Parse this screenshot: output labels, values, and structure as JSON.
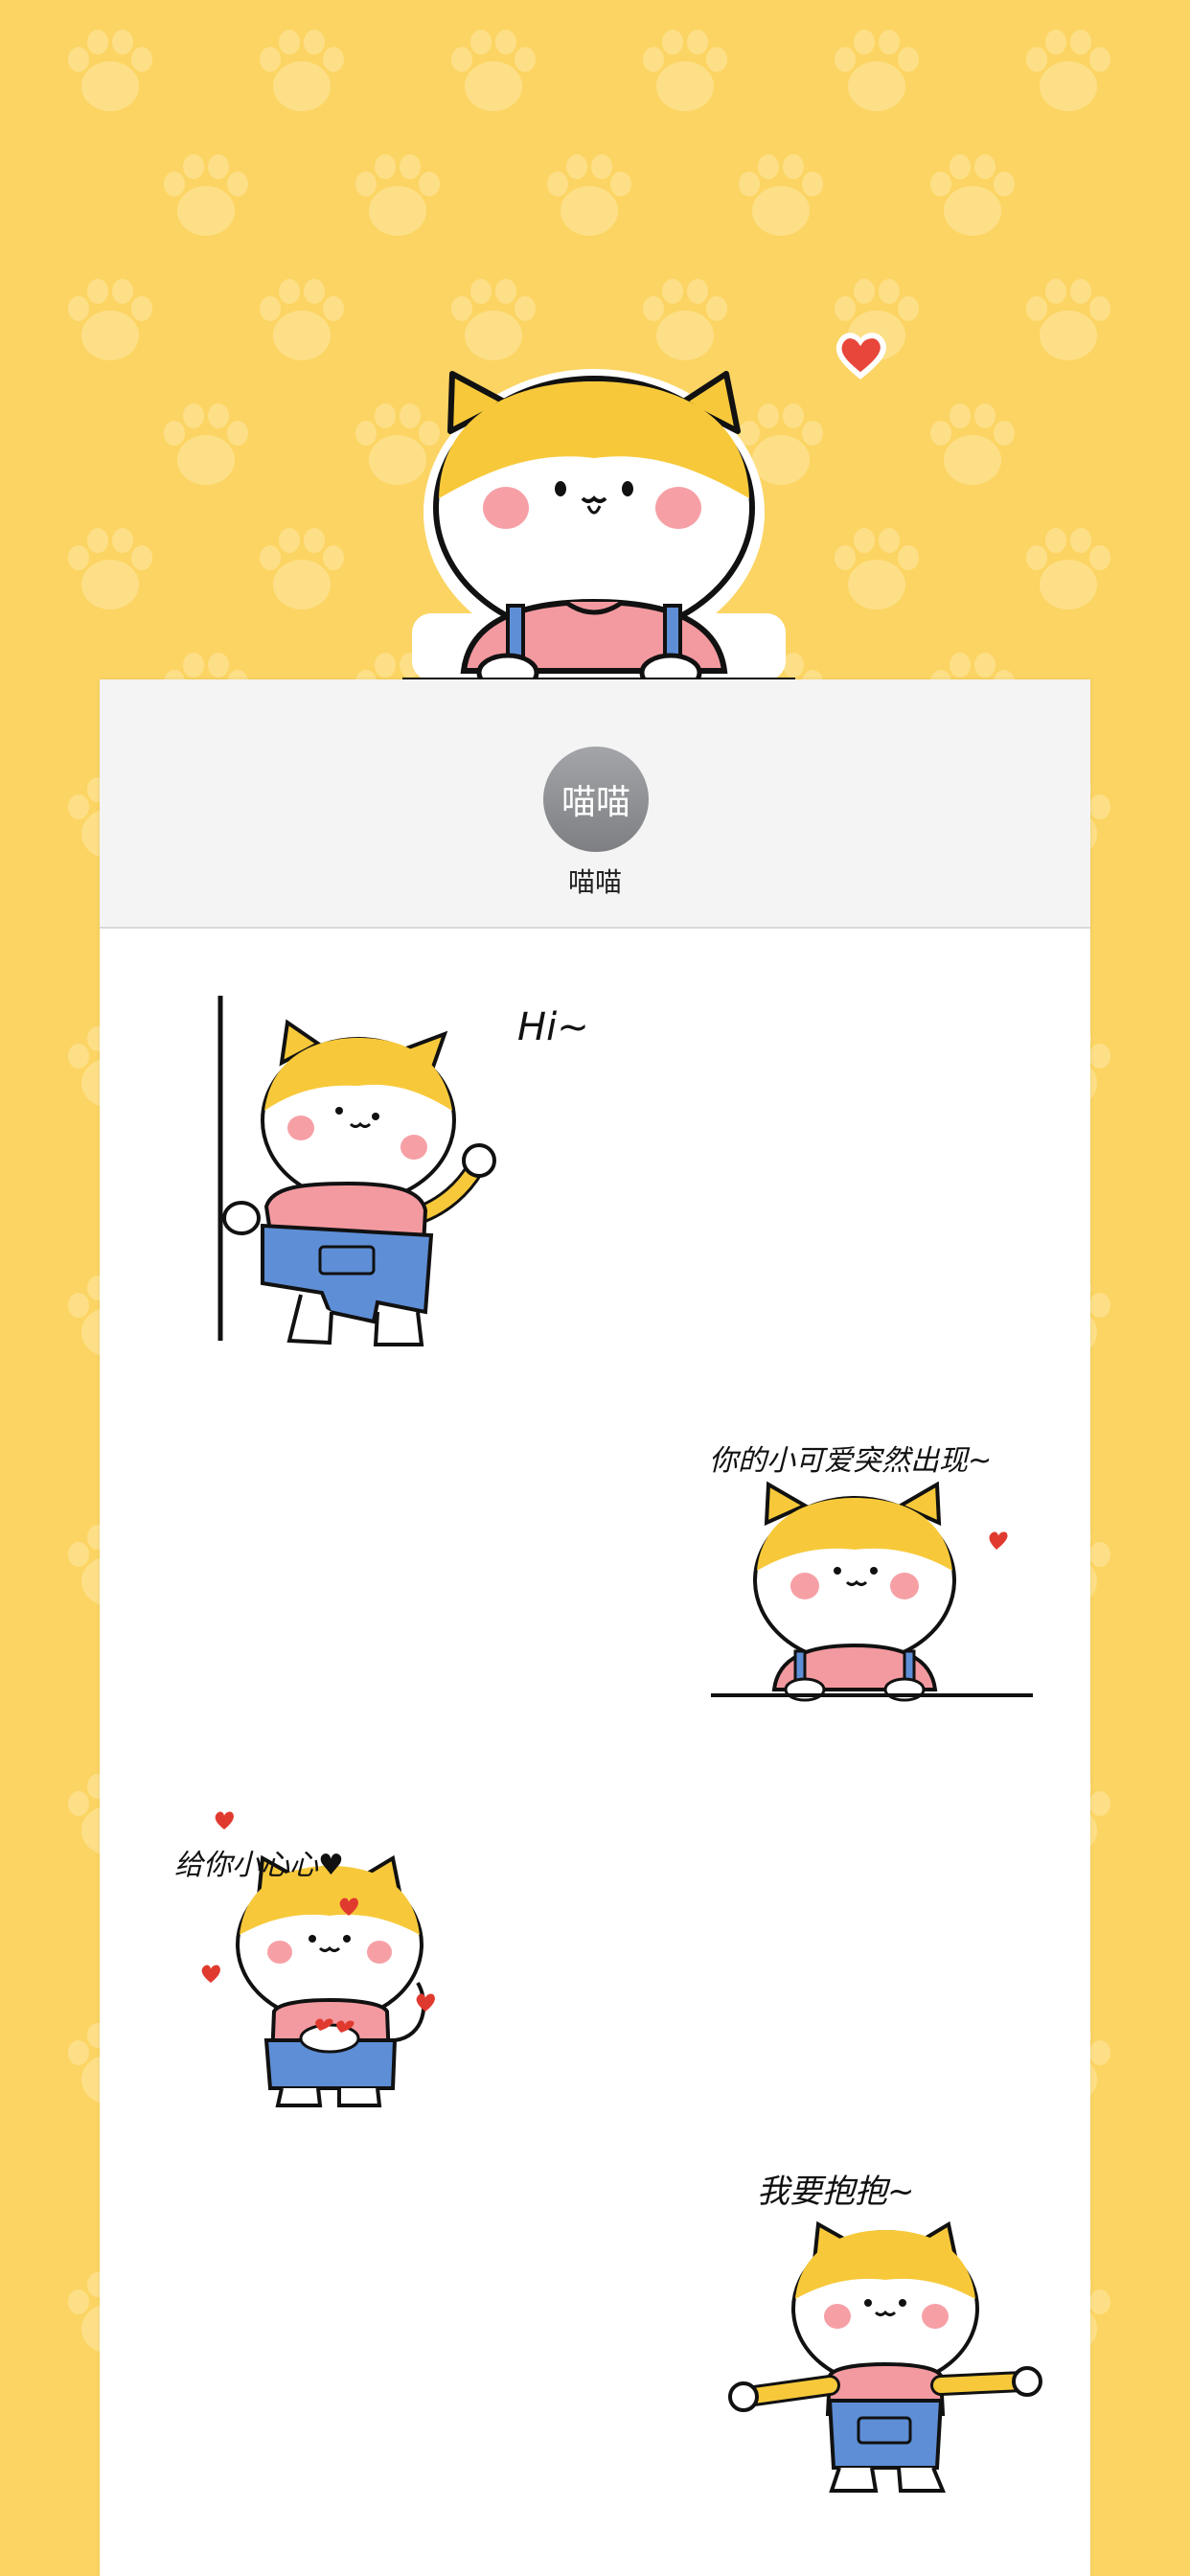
{
  "contact": {
    "avatar_text": "喵喵",
    "name": "喵喵"
  },
  "stickers": [
    {
      "caption": "Hi~",
      "icon": "cat-waving-sticker"
    },
    {
      "caption": "你的小可爱突然出现~",
      "icon": "cat-peeking-sticker"
    },
    {
      "caption": "给你小心心♥",
      "icon": "cat-hearts-sticker"
    },
    {
      "caption": "我要抱抱~",
      "icon": "cat-hug-sticker"
    }
  ],
  "colors": {
    "background": "#fbd463",
    "paw": "#ffe9a6",
    "cat_yellow": "#f7c93a",
    "cheek": "#f6a0a6",
    "shirt": "#f39aa0",
    "overalls": "#5e8ed6",
    "heart": "#e03a2f",
    "avatar": "#8f9195"
  }
}
